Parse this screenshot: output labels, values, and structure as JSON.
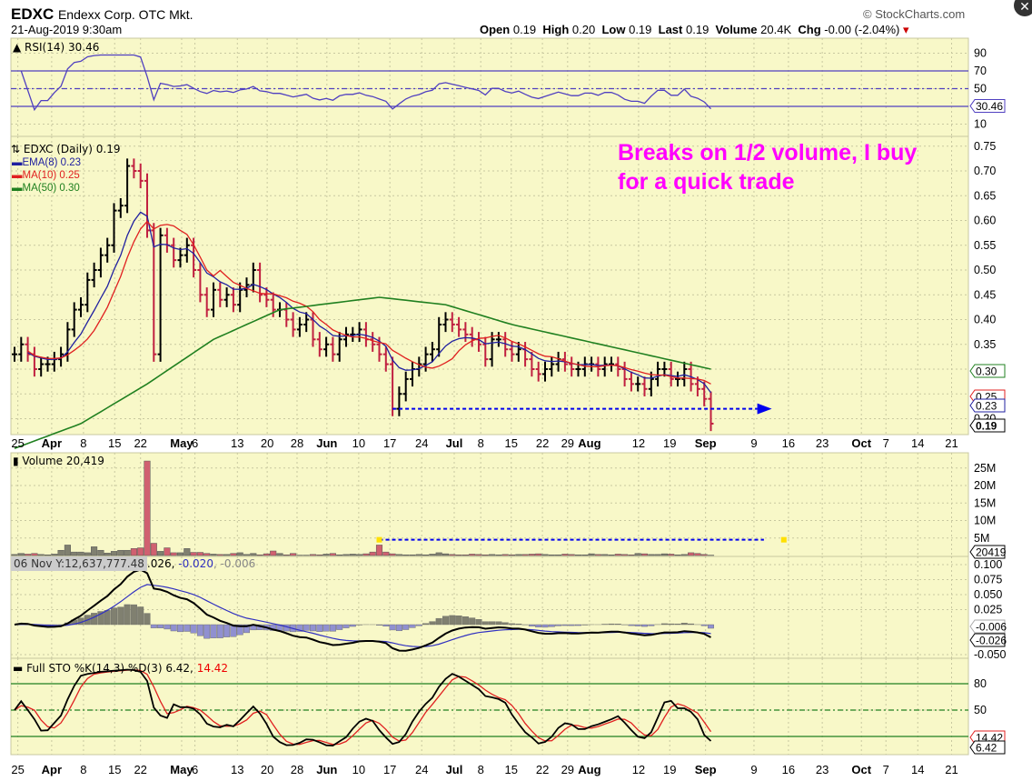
{
  "header": {
    "symbol": "EDXC",
    "company": "Endexx Corp. OTC Mkt.",
    "datetime": "21-Aug-2019 9:30am",
    "copyright": "© StockCharts.com",
    "open_label": "Open",
    "open": "0.19",
    "high_label": "High",
    "high": "0.20",
    "low_label": "Low",
    "low": "0.19",
    "last_label": "Last",
    "last": "0.19",
    "volume_label": "Volume",
    "volume": "20.4K",
    "chg_label": "Chg",
    "chg": "-0.00 (-2.04%)"
  },
  "annotation": {
    "line1": "Breaks on 1/2 volume, I buy",
    "line2": "for a quick trade",
    "color": "#ff00ff"
  },
  "tooltip": "06 Nov Y:12,637,777.48",
  "chart_data": {
    "type": "line",
    "colors": {
      "panel": "#f8f8c8",
      "ema": "#2020a0",
      "ma10": "#e02020",
      "ma50": "#208020",
      "rsi": "#5040c0",
      "down": "#c02040",
      "up": "#000000",
      "arrow": "#0000ee"
    },
    "legends": {
      "rsi": "RSI(14) 30.46",
      "price": "EDXC (Daily) 0.19",
      "ema": "EMA(8) 0.23",
      "ma10": "MA(10) 0.25",
      "ma50": "MA(50) 0.30",
      "volume": "Volume 20,419",
      "macd_a": ".026,",
      "macd_b": "-0.020",
      "macd_c": ", -0.006",
      "sto_a": "Full STO %K(14,3) %D(3) 6.42,",
      "sto_b": "14.42"
    },
    "rsi_ticks": [
      90,
      70,
      50,
      30,
      10
    ],
    "rsi_value": "30.46",
    "price_ticks": [
      0.75,
      0.7,
      0.65,
      0.6,
      0.55,
      0.5,
      0.45,
      0.4,
      0.35,
      0.3,
      0.25,
      0.2
    ],
    "price_tags": {
      "ma50": "0.30",
      "ma10": "0.25",
      "ema": "0.23",
      "last": "0.19"
    },
    "volume_ticks": [
      "25M",
      "20M",
      "15M",
      "10M",
      "5M"
    ],
    "volume_tag": "20419",
    "macd_ticks": [
      "0.100",
      "0.075",
      "0.050",
      "0.025",
      "-0.050"
    ],
    "macd_tags": {
      "hist": "-0.006",
      "macd": "-0.026"
    },
    "sto_ticks": [
      80,
      50,
      20
    ],
    "sto_tags": {
      "d": "14.42",
      "k": "6.42"
    },
    "x_ticks": [
      {
        "t": "25",
        "i": 0.5
      },
      {
        "t": "Apr",
        "i": 5.6,
        "b": 1
      },
      {
        "t": "8",
        "i": 10.4
      },
      {
        "t": "15",
        "i": 15.1
      },
      {
        "t": "22",
        "i": 19
      },
      {
        "t": "May",
        "i": 25.2,
        "b": 1
      },
      {
        "t": "6",
        "i": 27.2
      },
      {
        "t": "13",
        "i": 33.6
      },
      {
        "t": "20",
        "i": 38.1
      },
      {
        "t": "28",
        "i": 42.6
      },
      {
        "t": "Jun",
        "i": 47.1,
        "b": 1
      },
      {
        "t": "10",
        "i": 51.9
      },
      {
        "t": "17",
        "i": 56.6
      },
      {
        "t": "24",
        "i": 61.4
      },
      {
        "t": "Jul",
        "i": 66.3,
        "b": 1
      },
      {
        "t": "8",
        "i": 70.3
      },
      {
        "t": "15",
        "i": 74.9
      },
      {
        "t": "22",
        "i": 79.6
      },
      {
        "t": "29",
        "i": 83.4
      },
      {
        "t": "Aug",
        "i": 86.7,
        "b": 1
      },
      {
        "t": "12",
        "i": 94.1
      },
      {
        "t": "19",
        "i": 98.8
      },
      {
        "t": "Sep",
        "i": 104.2,
        "b": 1
      },
      {
        "t": "9",
        "i": 111.5
      },
      {
        "t": "16",
        "i": 116.7
      },
      {
        "t": "23",
        "i": 121.8
      },
      {
        "t": "Oct",
        "i": 127.7,
        "b": 1
      },
      {
        "t": "7",
        "i": 131.4
      },
      {
        "t": "14",
        "i": 136.2
      },
      {
        "t": "21",
        "i": 141.3
      }
    ],
    "close": [
      0.33,
      0.35,
      0.33,
      0.3,
      0.31,
      0.31,
      0.32,
      0.33,
      0.38,
      0.42,
      0.43,
      0.48,
      0.5,
      0.53,
      0.55,
      0.62,
      0.63,
      0.71,
      0.7,
      0.68,
      0.58,
      0.33,
      0.57,
      0.55,
      0.52,
      0.53,
      0.55,
      0.5,
      0.45,
      0.42,
      0.46,
      0.44,
      0.45,
      0.43,
      0.46,
      0.47,
      0.5,
      0.45,
      0.44,
      0.42,
      0.42,
      0.4,
      0.38,
      0.39,
      0.4,
      0.36,
      0.34,
      0.35,
      0.33,
      0.36,
      0.37,
      0.37,
      0.38,
      0.36,
      0.35,
      0.33,
      0.31,
      0.22,
      0.25,
      0.28,
      0.3,
      0.31,
      0.33,
      0.34,
      0.39,
      0.4,
      0.39,
      0.38,
      0.37,
      0.36,
      0.35,
      0.32,
      0.36,
      0.36,
      0.34,
      0.33,
      0.34,
      0.32,
      0.3,
      0.29,
      0.3,
      0.31,
      0.32,
      0.31,
      0.3,
      0.3,
      0.31,
      0.31,
      0.3,
      0.31,
      0.31,
      0.3,
      0.28,
      0.27,
      0.27,
      0.26,
      0.28,
      0.3,
      0.3,
      0.28,
      0.28,
      0.3,
      0.27,
      0.26,
      0.24,
      0.19
    ],
    "volume_m": [
      0.3,
      0.6,
      0.4,
      0.6,
      0.3,
      0.2,
      0.4,
      1.5,
      3.0,
      1.0,
      1.0,
      0.8,
      2.5,
      1.5,
      0.7,
      1.2,
      1.5,
      1.5,
      2.0,
      2.2,
      27,
      3.5,
      1.2,
      2.2,
      0.8,
      0.8,
      2.0,
      0.9,
      0.9,
      0.6,
      0.4,
      0.3,
      0.3,
      0.6,
      0.8,
      0.3,
      0.6,
      0.2,
      0.5,
      1.3,
      0.6,
      0.2,
      0.6,
      0.1,
      0.1,
      0.3,
      0.2,
      0.4,
      0.6,
      0.2,
      0.3,
      0.4,
      0.3,
      0.5,
      1.0,
      3.0,
      1.0,
      0.5,
      0.3,
      0.2,
      0.2,
      0.3,
      0.2,
      0.4,
      0.8,
      0.5,
      0.3,
      0.2,
      0.2,
      0.4,
      0.3,
      0.2,
      0.3,
      0.2,
      0.3,
      0.2,
      0.3,
      0.3,
      0.4,
      0.5,
      0.3,
      0.2,
      0.2,
      0.4,
      0.3,
      0.2,
      0.2,
      0.5,
      0.3,
      0.3,
      0.2,
      0.4,
      0.3,
      0.2,
      0.6,
      0.5,
      0.3,
      0.3,
      0.5,
      0.4,
      0.2,
      0.3,
      0.8,
      0.6,
      0.3,
      0.1
    ],
    "ma50_points": [
      [
        0,
        0.14
      ],
      [
        10,
        0.19
      ],
      [
        20,
        0.27
      ],
      [
        30,
        0.36
      ],
      [
        40,
        0.42
      ],
      [
        55,
        0.445
      ],
      [
        65,
        0.43
      ],
      [
        75,
        0.39
      ],
      [
        85,
        0.36
      ],
      [
        95,
        0.33
      ],
      [
        105,
        0.3
      ]
    ],
    "arrow_price": 0.22,
    "arrow_from": 57,
    "arrow_to": 112,
    "vol_arrow_m": 4.5,
    "vol_arrow_from": 55,
    "vol_arrow_to": 113
  }
}
